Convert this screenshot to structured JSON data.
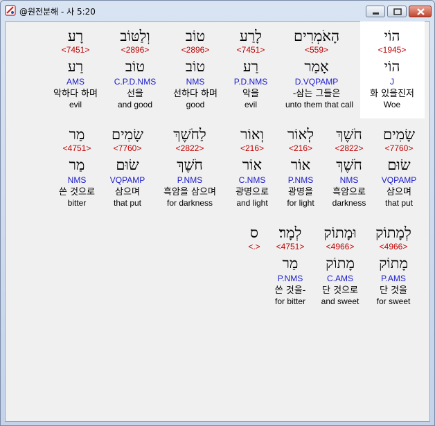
{
  "window": {
    "title": "@원전분해 - 사 5:20"
  },
  "row1": [
    {
      "heb": "רָע",
      "strong": "<7451>",
      "lemma": "רַע",
      "parse": "AMS",
      "kor": "악하다 하며",
      "eng": "evil"
    },
    {
      "heb": "וְלַטּוֹב",
      "strong": "<2896>",
      "lemma": "טוֹב",
      "parse": "C.P.D.NMS",
      "kor": "선을",
      "eng": "and good"
    },
    {
      "heb": "טוֹב",
      "strong": "<2896>",
      "lemma": "טוֹב",
      "parse": "NMS",
      "kor": "선하다 하며",
      "eng": "good"
    },
    {
      "heb": "לָרַע",
      "strong": "<7451>",
      "lemma": "רַע",
      "parse": "P.D.NMS",
      "kor": "악을",
      "eng": "evil"
    },
    {
      "heb": "הָאֹמְרִים",
      "strong": "<559>",
      "lemma": "אָמַר",
      "parse": "D.VQPAMP",
      "kor": "-삼는 그들은",
      "eng": "unto them that call"
    },
    {
      "heb": "הוֹי",
      "strong": "<1945>",
      "lemma": "הוֹי",
      "parse": "J",
      "kor": "화 있을진저",
      "eng": "Woe"
    }
  ],
  "row2": [
    {
      "heb": "מַר",
      "strong": "<4751>",
      "lemma": "מַר",
      "parse": "NMS",
      "kor": "쓴 것으로",
      "eng": "bitter"
    },
    {
      "heb": "שָׂמִים",
      "strong": "<7760>",
      "lemma": "שׂוּם",
      "parse": "VQPAMP",
      "kor": "삼으며",
      "eng": "that put"
    },
    {
      "heb": "לַחֹשֶׁךְ",
      "strong": "<2822>",
      "lemma": "חֹשֶׁךְ",
      "parse": "P.NMS",
      "kor": "흑암을 삼으며",
      "eng": "for darkness"
    },
    {
      "heb": "וְאוֹר",
      "strong": "<216>",
      "lemma": "אוֹר",
      "parse": "C.NMS",
      "kor": "광명으로",
      "eng": "and light"
    },
    {
      "heb": "לְאוֹר",
      "strong": "<216>",
      "lemma": "אוֹר",
      "parse": "P.NMS",
      "kor": "광명을",
      "eng": "for light"
    },
    {
      "heb": "חֹשֶׁךְ",
      "strong": "<2822>",
      "lemma": "חֹשֶׁךְ",
      "parse": "NMS",
      "kor": "흑암으로",
      "eng": "darkness"
    },
    {
      "heb": "שָׂמִים",
      "strong": "<7760>",
      "lemma": "שׂוּם",
      "parse": "VQPAMP",
      "kor": "삼으며",
      "eng": "that put"
    }
  ],
  "row3": [
    {
      "heb": "ס",
      "strong": "<.>",
      "lemma": "",
      "parse": "",
      "kor": "",
      "eng": ""
    },
    {
      "heb": "לְמָר׃",
      "strong": "<4751>",
      "lemma": "מַר",
      "parse": "P.NMS",
      "kor": "쓴 것을-",
      "eng": "for bitter"
    },
    {
      "heb": "וּמָתוֹק",
      "strong": "<4966>",
      "lemma": "מָתוֹק",
      "parse": "C.AMS",
      "kor": "단 것으로",
      "eng": "and sweet"
    },
    {
      "heb": "לְמָתוֹק",
      "strong": "<4966>",
      "lemma": "מָתוֹק",
      "parse": "P.AMS",
      "kor": "단 것을",
      "eng": "for sweet"
    }
  ]
}
